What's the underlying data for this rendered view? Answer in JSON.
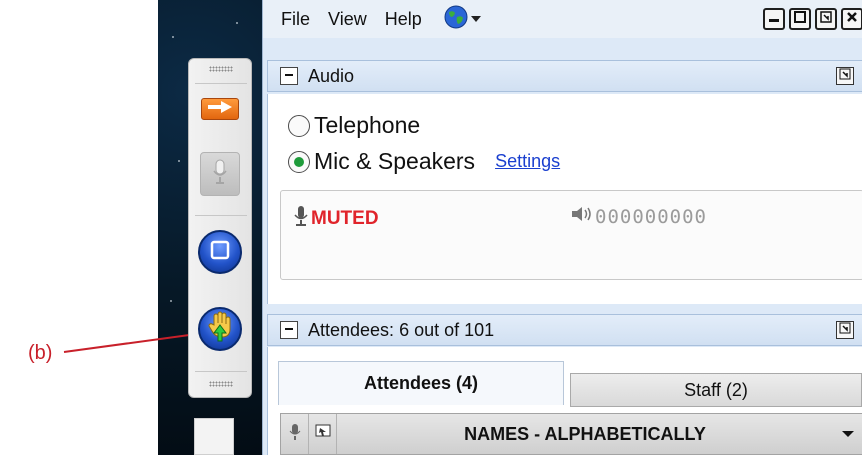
{
  "annotation": {
    "label": "(b)",
    "color": "#c8202a"
  },
  "menu": {
    "file": "File",
    "view": "View",
    "help": "Help"
  },
  "audio": {
    "title": "Audio",
    "options": [
      {
        "label": "Telephone",
        "selected": false
      },
      {
        "label": "Mic & Speakers",
        "selected": true
      }
    ],
    "settings_link": "Settings",
    "mute_status": "MUTED",
    "level_readout": "000000000"
  },
  "attendees": {
    "title": "Attendees:  6 out of 101",
    "tabs": [
      {
        "label": "Attendees (4)",
        "active": true
      },
      {
        "label": "Staff (2)",
        "active": false
      }
    ],
    "names_header": "NAMES - ALPHABETICALLY"
  },
  "icons": {
    "toolbar": [
      "arrow-right-icon",
      "microphone-icon",
      "stop-icon",
      "raise-hand-icon"
    ],
    "window": [
      "minimize-icon",
      "maximize-icon",
      "restore-icon",
      "close-icon"
    ],
    "menu": "globe-icon"
  },
  "colors": {
    "muted": "#e0242b",
    "link": "#1a3fcf",
    "radio_selected": "#1e9b3a",
    "accent_orange": "#e2660f",
    "accent_blue": "#2253c9"
  }
}
